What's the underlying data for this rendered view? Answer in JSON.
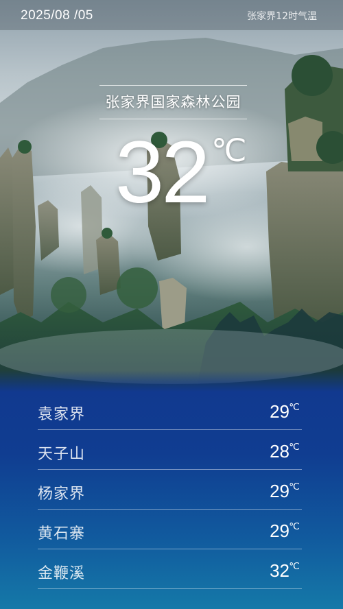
{
  "header": {
    "date": "2025/08 /05",
    "subtitle": "张家界12时气温"
  },
  "hero": {
    "park_name": "张家界国家森林公园",
    "temperature": "32",
    "unit": "℃"
  },
  "stations": [
    {
      "name": "袁家界",
      "temp": "29",
      "unit": "℃"
    },
    {
      "name": "天子山",
      "temp": "28",
      "unit": "℃"
    },
    {
      "name": "杨家界",
      "temp": "29",
      "unit": "℃"
    },
    {
      "name": "黄石寨",
      "temp": "29",
      "unit": "℃"
    },
    {
      "name": "金鞭溪",
      "temp": "32",
      "unit": "℃"
    }
  ],
  "colors": {
    "panel": "#103d91",
    "panel_bottom": "#1579a8",
    "text": "#ffffff"
  }
}
